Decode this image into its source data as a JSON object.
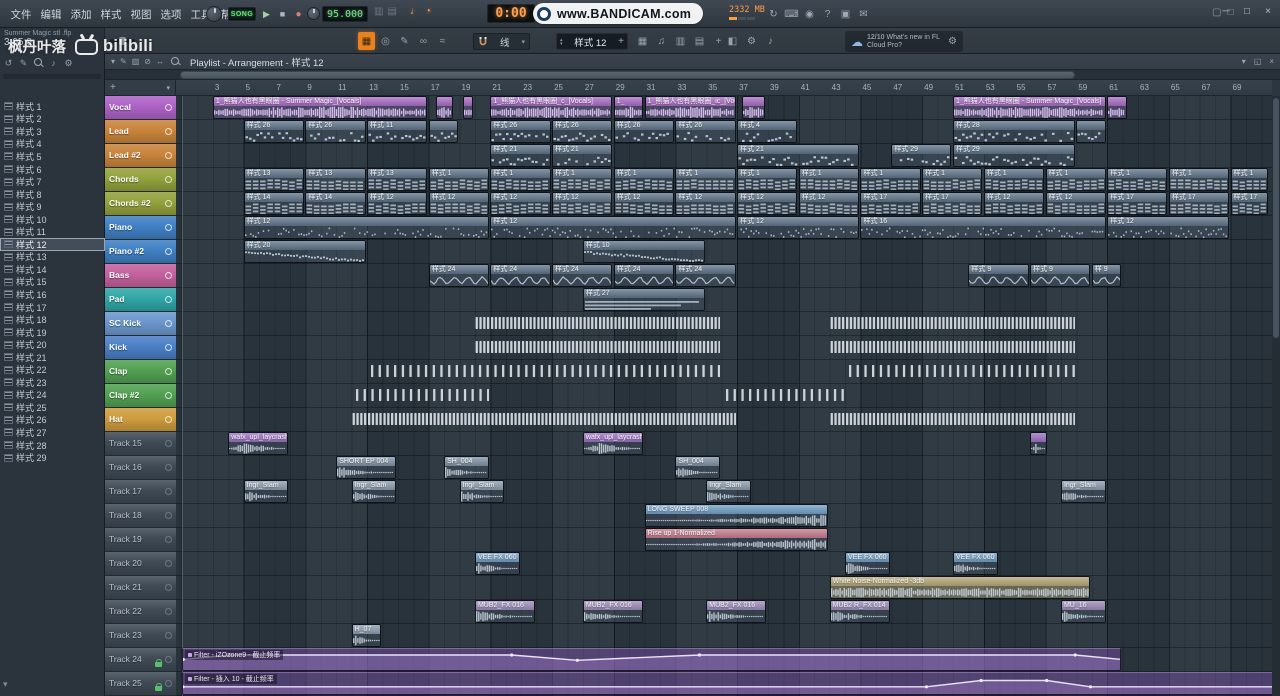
{
  "menu": {
    "items": [
      "文件",
      "编辑",
      "添加",
      "样式",
      "视图",
      "选项",
      "工具",
      "帮助"
    ]
  },
  "transport": {
    "mode": "SONG",
    "tempo": "95.000",
    "time": "0:00",
    "memory": "2332 MB"
  },
  "watermarks": {
    "bandicam": "www.BANDICAM.com",
    "uploader": "枫丹叶落",
    "site": "bilibili"
  },
  "hint": {
    "line1": "Summer Magic stl .flp",
    "line2": "3:05:0"
  },
  "toolbar": {
    "snap": "线",
    "pattern": "样式 12",
    "notif_date": "12/10",
    "notif_line1": "What's new in FL",
    "notif_line2": "Cloud Pro?"
  },
  "playlist": {
    "title": "Playlist - Arrangement - 样式 12"
  },
  "browser": {
    "selected": "样式 12",
    "patterns": [
      "样式 1",
      "样式 2",
      "样式 3",
      "样式 4",
      "样式 5",
      "样式 6",
      "样式 7",
      "样式 8",
      "样式 9",
      "样式 10",
      "样式 11",
      "样式 12",
      "样式 13",
      "样式 14",
      "样式 15",
      "样式 16",
      "样式 17",
      "样式 18",
      "样式 19",
      "样式 20",
      "样式 21",
      "样式 22",
      "样式 23",
      "样式 24",
      "样式 25",
      "样式 26",
      "样式 27",
      "样式 28",
      "样式 29"
    ]
  },
  "ruler": {
    "start": 3,
    "step": 2,
    "end": 69
  },
  "tracks": [
    {
      "name": "Vocal",
      "color": "#ad62c6"
    },
    {
      "name": "Lead",
      "color": "#c9843b"
    },
    {
      "name": "Lead #2",
      "color": "#c9843b"
    },
    {
      "name": "Chords",
      "color": "#93a23c"
    },
    {
      "name": "Chords #2",
      "color": "#93a23c"
    },
    {
      "name": "Piano",
      "color": "#3f80c3"
    },
    {
      "name": "Piano #2",
      "color": "#3f80c3"
    },
    {
      "name": "Bass",
      "color": "#c4619e"
    },
    {
      "name": "Pad",
      "color": "#30a6a6"
    },
    {
      "name": "SC Kick",
      "color": "#6b97cd"
    },
    {
      "name": "Kick",
      "color": "#4a7fc6"
    },
    {
      "name": "Clap",
      "color": "#52a152"
    },
    {
      "name": "Clap #2",
      "color": "#52a152"
    },
    {
      "name": "Hat",
      "color": "#cf9c3e"
    },
    {
      "name": "Track 15",
      "color": null
    },
    {
      "name": "Track 16",
      "color": null
    },
    {
      "name": "Track 17",
      "color": null
    },
    {
      "name": "Track 18",
      "color": null
    },
    {
      "name": "Track 19",
      "color": null
    },
    {
      "name": "Track 20",
      "color": null
    },
    {
      "name": "Track 21",
      "color": null
    },
    {
      "name": "Track 22",
      "color": null
    },
    {
      "name": "Track 23",
      "color": null
    },
    {
      "name": "Track 24",
      "color": null,
      "locked": true
    },
    {
      "name": "Track 25",
      "color": null,
      "locked": true
    }
  ],
  "icons": {
    "menubar_right": [
      "sync-icon",
      "typing-keyboard-icon",
      "mic-icon",
      "help-icon",
      "save-icon",
      "chat-icon"
    ],
    "window_controls": [
      "minimize-icon",
      "maximize-icon",
      "close-icon"
    ],
    "toolbar_left_group": [
      "playlist-grid-icon",
      "target-icon",
      "draw-icon",
      "link-icon",
      "spray-icon"
    ],
    "panel_group": [
      "channel-rack-icon",
      "piano-roll-icon",
      "mixer-icon",
      "browser-icon",
      "plugin-icon"
    ],
    "extra_group": [
      "touch-icon",
      "settings-icon",
      "note-icon"
    ],
    "browser_toolbar": [
      "refresh-icon",
      "pencil-icon",
      "search-icon",
      "sound-icon",
      "gear-icon"
    ],
    "playlist_tools": [
      "menu-down-icon",
      "pencil-icon",
      "paint-icon",
      "delete-icon",
      "slip-icon",
      "zoom-icon"
    ],
    "playlist_window_controls": [
      "menu-down-icon",
      "detach-icon",
      "close-icon"
    ]
  },
  "clips": [
    {
      "t": 0,
      "b": 3,
      "l": 14,
      "n": "1_熊猫人也有黑眼圈 - Summer Magic_[Vocals]",
      "k": "audio",
      "w": "vox",
      "c": "#a76bc2"
    },
    {
      "t": 0,
      "b": 17.5,
      "l": 1.2,
      "n": "",
      "k": "audio",
      "w": "vox",
      "c": "#a76bc2"
    },
    {
      "t": 0,
      "b": 19.2,
      "l": 0.8,
      "n": "",
      "k": "audio",
      "w": "vox",
      "c": "#a76bc2"
    },
    {
      "t": 0,
      "b": 21,
      "l": 8,
      "n": "1_熊猫人也有黑眼圈_c_[Vocals]",
      "k": "audio",
      "w": "vox",
      "c": "#a76bc2"
    },
    {
      "t": 0,
      "b": 29,
      "l": 2,
      "n": "1_",
      "k": "audio",
      "w": "vox",
      "c": "#a76bc2"
    },
    {
      "t": 0,
      "b": 31,
      "l": 6,
      "n": "1_熊猫人也有黑眼圈_ic_[Vocals]",
      "k": "audio",
      "w": "vox",
      "c": "#a76bc2"
    },
    {
      "t": 0,
      "b": 37.3,
      "l": 1.6,
      "n": "",
      "k": "audio",
      "w": "vox",
      "c": "#a76bc2"
    },
    {
      "t": 0,
      "b": 51,
      "l": 10,
      "n": "1_熊猫人也有黑眼圈 - Summer Magic_[Vocals]",
      "k": "audio",
      "w": "vox",
      "c": "#a76bc2"
    },
    {
      "t": 0,
      "b": 61,
      "l": 1.4,
      "n": "",
      "k": "audio",
      "w": "vox",
      "c": "#a76bc2"
    },
    {
      "t": 1,
      "b": 5,
      "l": 4,
      "n": "样式 26",
      "k": "pat",
      "w": "notes"
    },
    {
      "t": 1,
      "b": 9,
      "l": 4,
      "n": "样式 26",
      "k": "pat",
      "w": "notes"
    },
    {
      "t": 1,
      "b": 13,
      "l": 4,
      "n": "样式 11",
      "k": "pat",
      "w": "notes"
    },
    {
      "t": 1,
      "b": 17,
      "l": 2,
      "n": "",
      "k": "pat",
      "w": "notes"
    },
    {
      "t": 1,
      "b": 21,
      "l": 4,
      "n": "样式 26",
      "k": "pat",
      "w": "notes"
    },
    {
      "t": 1,
      "b": 25,
      "l": 4,
      "n": "样式 26",
      "k": "pat",
      "w": "notes"
    },
    {
      "t": 1,
      "b": 29,
      "l": 4,
      "n": "样式 26",
      "k": "pat",
      "w": "notes"
    },
    {
      "t": 1,
      "b": 33,
      "l": 4,
      "n": "样式 26",
      "k": "pat",
      "w": "notes"
    },
    {
      "t": 1,
      "b": 37,
      "l": 4,
      "n": "样式 4",
      "k": "pat",
      "w": "notes"
    },
    {
      "t": 1,
      "b": 51,
      "l": 8,
      "n": "样式 28",
      "k": "pat",
      "w": "notes"
    },
    {
      "t": 1,
      "b": 59,
      "l": 2,
      "n": "",
      "k": "pat",
      "w": "notes"
    },
    {
      "t": 2,
      "b": 21,
      "l": 4,
      "n": "样式 21",
      "k": "pat",
      "w": "notes"
    },
    {
      "t": 2,
      "b": 25,
      "l": 4,
      "n": "样式 21",
      "k": "pat",
      "w": "notes"
    },
    {
      "t": 2,
      "b": 37,
      "l": 8,
      "n": "样式 21",
      "k": "pat",
      "w": "notes"
    },
    {
      "t": 2,
      "b": 47,
      "l": 4,
      "n": "样式 29",
      "k": "pat",
      "w": "notes"
    },
    {
      "t": 2,
      "b": 51,
      "l": 8,
      "n": "样式 29",
      "k": "pat",
      "w": "notes"
    },
    {
      "t": 3,
      "b": 5,
      "l": 4,
      "n": "样式 13",
      "k": "pat",
      "w": "chords"
    },
    {
      "t": 3,
      "b": 9,
      "l": 4,
      "n": "样式 13",
      "k": "pat",
      "w": "chords"
    },
    {
      "t": 3,
      "b": 13,
      "l": 4,
      "n": "样式 13",
      "k": "pat",
      "w": "chords"
    },
    {
      "t": 3,
      "b": 17,
      "l": 4,
      "n": "样式 1",
      "k": "pat",
      "w": "chords"
    },
    {
      "t": 3,
      "b": 21,
      "l": 4,
      "n": "样式 1",
      "k": "pat",
      "w": "chords"
    },
    {
      "t": 3,
      "b": 25,
      "l": 4,
      "n": "样式 1",
      "k": "pat",
      "w": "chords"
    },
    {
      "t": 3,
      "b": 29,
      "l": 4,
      "n": "样式 1",
      "k": "pat",
      "w": "chords"
    },
    {
      "t": 3,
      "b": 33,
      "l": 4,
      "n": "样式 1",
      "k": "pat",
      "w": "chords"
    },
    {
      "t": 3,
      "b": 37,
      "l": 4,
      "n": "样式 1",
      "k": "pat",
      "w": "chords"
    },
    {
      "t": 3,
      "b": 41,
      "l": 4,
      "n": "样式 1",
      "k": "pat",
      "w": "chords"
    },
    {
      "t": 3,
      "b": 45,
      "l": 4,
      "n": "样式 1",
      "k": "pat",
      "w": "chords"
    },
    {
      "t": 3,
      "b": 49,
      "l": 4,
      "n": "样式 1",
      "k": "pat",
      "w": "chords"
    },
    {
      "t": 3,
      "b": 53,
      "l": 4,
      "n": "样式 1",
      "k": "pat",
      "w": "chords"
    },
    {
      "t": 3,
      "b": 57,
      "l": 4,
      "n": "样式 1",
      "k": "pat",
      "w": "chords"
    },
    {
      "t": 3,
      "b": 61,
      "l": 4,
      "n": "样式 1",
      "k": "pat",
      "w": "chords"
    },
    {
      "t": 3,
      "b": 65,
      "l": 4,
      "n": "样式 1",
      "k": "pat",
      "w": "chords"
    },
    {
      "t": 3,
      "b": 69,
      "l": 2.5,
      "n": "样式 1",
      "k": "pat",
      "w": "chords"
    },
    {
      "t": 4,
      "b": 5,
      "l": 4,
      "n": "样式 14",
      "k": "pat",
      "w": "chords"
    },
    {
      "t": 4,
      "b": 9,
      "l": 4,
      "n": "样式 14",
      "k": "pat",
      "w": "chords"
    },
    {
      "t": 4,
      "b": 13,
      "l": 4,
      "n": "样式 12",
      "k": "pat",
      "w": "chords"
    },
    {
      "t": 4,
      "b": 17,
      "l": 4,
      "n": "样式 12",
      "k": "pat",
      "w": "chords"
    },
    {
      "t": 4,
      "b": 21,
      "l": 4,
      "n": "样式 12",
      "k": "pat",
      "w": "chords"
    },
    {
      "t": 4,
      "b": 25,
      "l": 4,
      "n": "样式 12",
      "k": "pat",
      "w": "chords"
    },
    {
      "t": 4,
      "b": 29,
      "l": 4,
      "n": "样式 12",
      "k": "pat",
      "w": "chords"
    },
    {
      "t": 4,
      "b": 33,
      "l": 4,
      "n": "样式 12",
      "k": "pat",
      "w": "chords"
    },
    {
      "t": 4,
      "b": 37,
      "l": 4,
      "n": "样式 12",
      "k": "pat",
      "w": "chords"
    },
    {
      "t": 4,
      "b": 41,
      "l": 4,
      "n": "样式 12",
      "k": "pat",
      "w": "chords"
    },
    {
      "t": 4,
      "b": 45,
      "l": 4,
      "n": "样式 17",
      "k": "pat",
      "w": "chords"
    },
    {
      "t": 4,
      "b": 49,
      "l": 4,
      "n": "样式 17",
      "k": "pat",
      "w": "chords"
    },
    {
      "t": 4,
      "b": 53,
      "l": 4,
      "n": "样式 12",
      "k": "pat",
      "w": "chords"
    },
    {
      "t": 4,
      "b": 57,
      "l": 4,
      "n": "样式 12",
      "k": "pat",
      "w": "chords"
    },
    {
      "t": 4,
      "b": 61,
      "l": 4,
      "n": "样式 17",
      "k": "pat",
      "w": "chords"
    },
    {
      "t": 4,
      "b": 65,
      "l": 4,
      "n": "样式 17",
      "k": "pat",
      "w": "chords"
    },
    {
      "t": 4,
      "b": 69,
      "l": 2.5,
      "n": "样式 17",
      "k": "pat",
      "w": "chords"
    },
    {
      "t": 5,
      "b": 5,
      "l": 16,
      "n": "样式 12",
      "k": "pat",
      "w": "piano"
    },
    {
      "t": 5,
      "b": 21,
      "l": 16,
      "n": "样式 12",
      "k": "pat",
      "w": "piano"
    },
    {
      "t": 5,
      "b": 37,
      "l": 8,
      "n": "样式 12",
      "k": "pat",
      "w": "piano"
    },
    {
      "t": 5,
      "b": 45,
      "l": 16,
      "n": "样式 16",
      "k": "pat",
      "w": "piano"
    },
    {
      "t": 5,
      "b": 61,
      "l": 8,
      "n": "样式 12",
      "k": "pat",
      "w": "piano"
    },
    {
      "t": 6,
      "b": 5,
      "l": 8,
      "n": "样式 20",
      "k": "pat",
      "w": "slide"
    },
    {
      "t": 6,
      "b": 27,
      "l": 8,
      "n": "样式 10",
      "k": "pat",
      "w": "slide"
    },
    {
      "t": 7,
      "b": 17,
      "l": 4,
      "n": "样式 24",
      "k": "pat",
      "w": "bass"
    },
    {
      "t": 7,
      "b": 21,
      "l": 4,
      "n": "样式 24",
      "k": "pat",
      "w": "bass"
    },
    {
      "t": 7,
      "b": 25,
      "l": 4,
      "n": "样式 24",
      "k": "pat",
      "w": "bass"
    },
    {
      "t": 7,
      "b": 29,
      "l": 4,
      "n": "样式 24",
      "k": "pat",
      "w": "bass"
    },
    {
      "t": 7,
      "b": 33,
      "l": 4,
      "n": "样式 24",
      "k": "pat",
      "w": "bass"
    },
    {
      "t": 7,
      "b": 52,
      "l": 4,
      "n": "样式 9",
      "k": "pat",
      "w": "bass"
    },
    {
      "t": 7,
      "b": 56,
      "l": 4,
      "n": "样式 9",
      "k": "pat",
      "w": "bass"
    },
    {
      "t": 7,
      "b": 60,
      "l": 2,
      "n": "样 9",
      "k": "pat",
      "w": "bass"
    },
    {
      "t": 8,
      "b": 27,
      "l": 8,
      "n": "样式 27",
      "k": "pat",
      "w": "long"
    },
    {
      "t": 9,
      "b": 20,
      "l": 16,
      "k": "beat",
      "p": 4
    },
    {
      "t": 9,
      "b": 43,
      "l": 16,
      "k": "beat",
      "p": 4
    },
    {
      "t": 10,
      "b": 20,
      "l": 16,
      "k": "beat",
      "p": 4
    },
    {
      "t": 10,
      "b": 43,
      "l": 16,
      "k": "beat",
      "p": 4
    },
    {
      "t": 11,
      "b": 13,
      "l": 23,
      "k": "beat",
      "p": 2
    },
    {
      "t": 11,
      "b": 44,
      "l": 15,
      "k": "beat",
      "p": 2
    },
    {
      "t": 12,
      "b": 12,
      "l": 9,
      "k": "beat",
      "p": 2
    },
    {
      "t": 12,
      "b": 36,
      "l": 8,
      "k": "beat",
      "p": 2
    },
    {
      "t": 13,
      "b": 12,
      "l": 25,
      "k": "beat",
      "p": 4
    },
    {
      "t": 13,
      "b": 43,
      "l": 16,
      "k": "beat",
      "p": 4
    },
    {
      "t": 14,
      "b": 4,
      "l": 4,
      "n": "wafx_upl_laycrash",
      "k": "audio",
      "w": "diamond",
      "c": "#9b6fc0"
    },
    {
      "t": 14,
      "b": 27,
      "l": 4,
      "n": "wafx_upl_laycrash",
      "k": "audio",
      "w": "diamond",
      "c": "#9b6fc0"
    },
    {
      "t": 14,
      "b": 56,
      "l": 1.2,
      "n": "",
      "k": "audio",
      "w": "diamond",
      "c": "#9b6fc0"
    },
    {
      "t": 15,
      "b": 11,
      "l": 4,
      "n": "SHORT EP 004",
      "k": "audio",
      "w": "decay",
      "c": "#7e90a4"
    },
    {
      "t": 15,
      "b": 18,
      "l": 3,
      "n": "SH_004",
      "k": "audio",
      "w": "decay",
      "c": "#7e90a4"
    },
    {
      "t": 15,
      "b": 33,
      "l": 3,
      "n": "SH_004",
      "k": "audio",
      "w": "decay",
      "c": "#7e90a4"
    },
    {
      "t": 16,
      "b": 5,
      "l": 3,
      "n": "Ingr_Slam",
      "k": "audio",
      "w": "decay",
      "c": "#8a9aab"
    },
    {
      "t": 16,
      "b": 12,
      "l": 3,
      "n": "Ingr_Slam",
      "k": "audio",
      "w": "decay",
      "c": "#8a9aab"
    },
    {
      "t": 16,
      "b": 19,
      "l": 3,
      "n": "Ingr_Slam",
      "k": "audio",
      "w": "decay",
      "c": "#8a9aab"
    },
    {
      "t": 16,
      "b": 35,
      "l": 3,
      "n": "Ingr_Slam",
      "k": "audio",
      "w": "decay",
      "c": "#8a9aab"
    },
    {
      "t": 16,
      "b": 58,
      "l": 3,
      "n": "Ingr_Slam",
      "k": "audio",
      "w": "decay",
      "c": "#8a9aab"
    },
    {
      "t": 17,
      "b": 31,
      "l": 12,
      "n": "LONG SWEEP 008",
      "k": "audio",
      "w": "rise",
      "c": "#6f9ec4"
    },
    {
      "t": 18,
      "b": 31,
      "l": 12,
      "n": "Rise up 1-Normalized",
      "k": "audio",
      "w": "rise",
      "c": "#c4798a"
    },
    {
      "t": 19,
      "b": 20,
      "l": 3,
      "n": "VEE FX 060",
      "k": "audio",
      "w": "decay",
      "c": "#6f9ec4"
    },
    {
      "t": 19,
      "b": 44,
      "l": 3,
      "n": "VEE FX 060",
      "k": "audio",
      "w": "decay",
      "c": "#6f9ec4"
    },
    {
      "t": 19,
      "b": 51,
      "l": 3,
      "n": "VEE FX 060",
      "k": "audio",
      "w": "decay",
      "c": "#6f9ec4"
    },
    {
      "t": 20,
      "b": 43,
      "l": 17,
      "n": "White Noise-Normalized -3db",
      "k": "audio",
      "w": "noise",
      "c": "#b3a575",
      "bg": "rgba(160,148,102,0.45)"
    },
    {
      "t": 21,
      "b": 20,
      "l": 4,
      "n": "MUB2_FX 016",
      "k": "audio",
      "w": "decay",
      "c": "#9b8ab8"
    },
    {
      "t": 21,
      "b": 27,
      "l": 4,
      "n": "MUB2_FX 016",
      "k": "audio",
      "w": "decay",
      "c": "#9b8ab8"
    },
    {
      "t": 21,
      "b": 35,
      "l": 4,
      "n": "MUB2_FX 016",
      "k": "audio",
      "w": "decay",
      "c": "#9b8ab8"
    },
    {
      "t": 21,
      "b": 43,
      "l": 4,
      "n": "MUB2 R_FX 014",
      "k": "audio",
      "w": "decay",
      "c": "#9b8ab8"
    },
    {
      "t": 21,
      "b": 58,
      "l": 3,
      "n": "MU_16",
      "k": "audio",
      "w": "decay",
      "c": "#9b8ab8"
    },
    {
      "t": 22,
      "b": 12,
      "l": 2,
      "n": "H_07",
      "k": "audio",
      "w": "decay",
      "c": "#8a9aab"
    },
    {
      "t": 23,
      "b": 1,
      "l": 61,
      "n": "Filter - iZOzone9 - 截止频率",
      "k": "auto",
      "c": "#8c5fbf",
      "pts": [
        [
          0,
          0.5
        ],
        [
          0.05,
          0.2
        ],
        [
          0.35,
          0.2
        ],
        [
          0.42,
          0.55
        ],
        [
          0.55,
          0.2
        ],
        [
          0.95,
          0.2
        ],
        [
          1,
          0.5
        ]
      ]
    },
    {
      "t": 24,
      "b": 1,
      "l": 71,
      "n": "Filter - 插入 10 - 截止频率",
      "k": "auto",
      "c": "#8c5fbf",
      "pts": [
        [
          0,
          0.72
        ],
        [
          0.68,
          0.72
        ],
        [
          0.73,
          0.3
        ],
        [
          0.79,
          0.3
        ],
        [
          0.83,
          0.72
        ],
        [
          1,
          0.72
        ]
      ]
    }
  ]
}
